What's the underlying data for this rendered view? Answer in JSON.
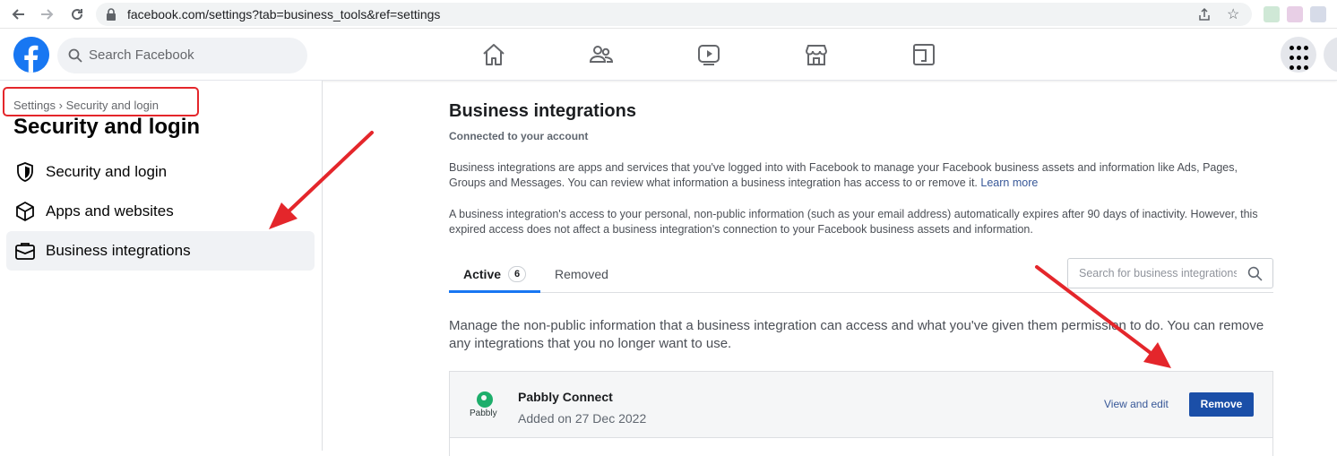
{
  "browser": {
    "url": "facebook.com/settings?tab=business_tools&ref=settings"
  },
  "header": {
    "search_placeholder": "Search Facebook"
  },
  "sidebar": {
    "breadcrumb_root": "Settings",
    "breadcrumb_separator": "›",
    "breadcrumb_current": "Security and login",
    "title": "Security and login",
    "items": [
      {
        "label": "Security and login",
        "icon": "shield-icon",
        "active": false
      },
      {
        "label": "Apps and websites",
        "icon": "cube-icon",
        "active": false
      },
      {
        "label": "Business integrations",
        "icon": "briefcase-icon",
        "active": true
      }
    ]
  },
  "main": {
    "title": "Business integrations",
    "subtitle": "Connected to your account",
    "para1": "Business integrations are apps and services that you've logged into with Facebook to manage your Facebook business assets and information like Ads, Pages, Groups and Messages. You can review what information a business integration has access to or remove it.",
    "learn_more": "Learn more",
    "para2": "A business integration's access to your personal, non-public information (such as your email address) automatically expires after 90 days of inactivity. However, this expired access does not affect a business integration's connection to your Facebook business assets and information.",
    "tabs": [
      {
        "label": "Active",
        "count": "6"
      },
      {
        "label": "Removed"
      }
    ],
    "search_placeholder": "Search for business integrations",
    "manage_text": "Manage the non-public information that a business integration can access and what you've given them permission to do. You can remove any integrations that you no longer want to use.",
    "integration": {
      "logo_text": "Pabbly",
      "name": "Pabbly Connect",
      "added": "Added on 27 Dec 2022",
      "view_edit": "View and edit",
      "remove": "Remove"
    }
  },
  "colors": {
    "fb_blue": "#1877f2",
    "remove_button": "#1b4fa8",
    "annotation_red": "#e4262b",
    "pabbly_green": "#1dae6b"
  }
}
